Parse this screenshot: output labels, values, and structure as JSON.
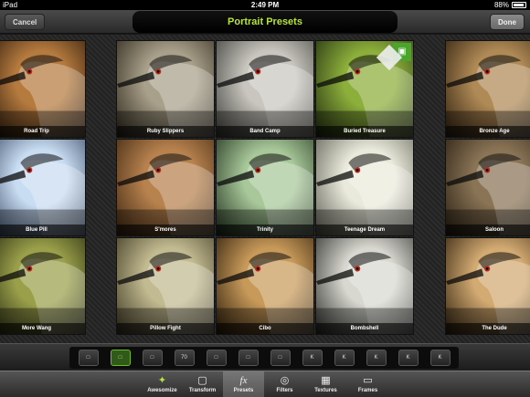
{
  "status_bar": {
    "device": "iPad",
    "time": "2:49 PM",
    "battery": "88%",
    "battery_level": 0.88
  },
  "nav": {
    "cancel": "Cancel",
    "title": "Portrait Presets",
    "done": "Done"
  },
  "presets": [
    {
      "label": "Road Trip",
      "tint": "#b57a3e",
      "vignette": "#1a0d05"
    },
    {
      "label": "Ruby Slippers",
      "tint": "#a8a08a",
      "vignette": "#2a2216"
    },
    {
      "label": "Band Camp",
      "tint": "#c8c6be",
      "vignette": "#3a3a36"
    },
    {
      "label": "Buried Treasure",
      "tint": "#8cae3a",
      "vignette": "#1e2a0e",
      "locked": true
    },
    {
      "label": "Bronze Age",
      "tint": "#b08a56",
      "vignette": "#2a1c0c"
    },
    {
      "label": "Blue Pill",
      "tint": "#c8dcf2",
      "vignette": "#2a3a52"
    },
    {
      "label": "S'mores",
      "tint": "#b8824e",
      "vignette": "#3a2410"
    },
    {
      "label": "Trinity",
      "tint": "#a8c89a",
      "vignette": "#1e2e1a"
    },
    {
      "label": "Teenage Dream",
      "tint": "#eaeadc",
      "vignette": "#5a5a50"
    },
    {
      "label": "Saloon",
      "tint": "#8a7456",
      "vignette": "#261c10"
    },
    {
      "label": "More Wang",
      "tint": "#9aa04a",
      "vignette": "#1a1c0a"
    },
    {
      "label": "Pillow Fight",
      "tint": "#c2ba90",
      "vignette": "#3a3420"
    },
    {
      "label": "Cibo",
      "tint": "#c89a5a",
      "vignette": "#2a1a08"
    },
    {
      "label": "Bombshell",
      "tint": "#d8d8d0",
      "vignette": "#2a2a28"
    },
    {
      "label": "The Dude",
      "tint": "#d2aa72",
      "vignette": "#2e1e0c"
    }
  ],
  "filter_buttons": [
    {
      "icon": "blank-square-icon",
      "text": ""
    },
    {
      "icon": "portrait-frame-icon",
      "text": "",
      "active": true
    },
    {
      "icon": "photo-icon",
      "text": ""
    },
    {
      "icon": "number-icon",
      "text": "70"
    },
    {
      "icon": "contrast-icon",
      "text": ""
    },
    {
      "icon": "screen-icon",
      "text": ""
    },
    {
      "icon": "note-icon",
      "text": ""
    },
    {
      "icon": "k1-icon",
      "text": "K"
    },
    {
      "icon": "k2-icon",
      "text": "K"
    },
    {
      "icon": "k3-icon",
      "text": "K"
    },
    {
      "icon": "k4-icon",
      "text": "K"
    },
    {
      "icon": "k5-icon",
      "text": "K"
    }
  ],
  "tabs": [
    {
      "label": "Awesomize",
      "icon": "awesomize-icon"
    },
    {
      "label": "Transform",
      "icon": "transform-icon"
    },
    {
      "label": "Presets",
      "icon": "fx-icon",
      "active": true
    },
    {
      "label": "Filters",
      "icon": "filters-icon"
    },
    {
      "label": "Textures",
      "icon": "textures-icon"
    },
    {
      "label": "Frames",
      "icon": "frames-icon"
    }
  ],
  "colors": {
    "accent": "#b8e33a",
    "cart": "#4aa52a"
  }
}
